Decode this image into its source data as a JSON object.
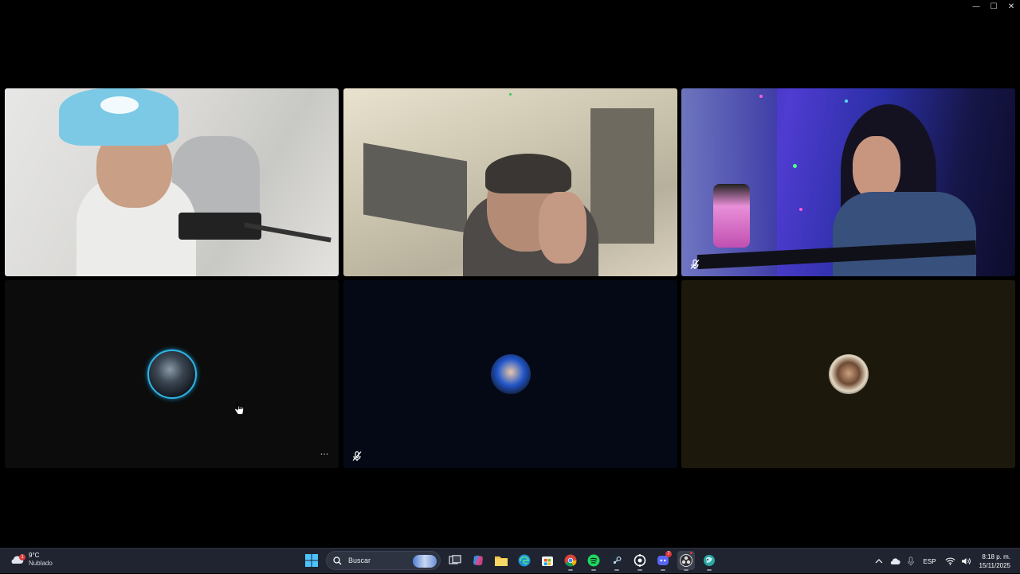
{
  "window": {
    "controls": {
      "minimize": "—",
      "maximize": "☐",
      "close": "✕"
    }
  },
  "call": {
    "participants": [
      {
        "tile": "video",
        "camera": "on"
      },
      {
        "tile": "video",
        "camera": "on"
      },
      {
        "tile": "video",
        "camera": "on",
        "muted": true
      },
      {
        "tile": "avatar",
        "camera": "off",
        "speaking_ring": true,
        "more_menu": "···"
      },
      {
        "tile": "avatar",
        "camera": "off",
        "muted": true
      },
      {
        "tile": "avatar",
        "camera": "off"
      }
    ]
  },
  "taskbar": {
    "weather": {
      "temperature": "9°C",
      "condition": "Nublado",
      "badge": "1"
    },
    "search": {
      "placeholder": "Buscar"
    },
    "apps": [
      {
        "icon": "windows-start-icon"
      },
      {
        "icon": "task-view-icon"
      },
      {
        "icon": "copilot-icon"
      },
      {
        "icon": "file-explorer-icon"
      },
      {
        "icon": "edge-icon"
      },
      {
        "icon": "microsoft-store-icon"
      },
      {
        "icon": "chrome-icon"
      },
      {
        "icon": "spotify-icon"
      },
      {
        "icon": "steam-icon"
      },
      {
        "icon": "app-icon"
      },
      {
        "icon": "discord-icon",
        "badge": "7"
      },
      {
        "icon": "obs-icon"
      },
      {
        "icon": "app-icon-2"
      }
    ],
    "tray": {
      "language": "ESP",
      "time": "8:18 p. m.",
      "date": "15/11/2025"
    }
  },
  "colors": {
    "taskbar_bg": "#1f2430",
    "speaking_ring": "#2fb6e6",
    "tile_bg_4": "#0c0c0c",
    "tile_bg_5": "#040915",
    "tile_bg_6": "#1c190c"
  }
}
